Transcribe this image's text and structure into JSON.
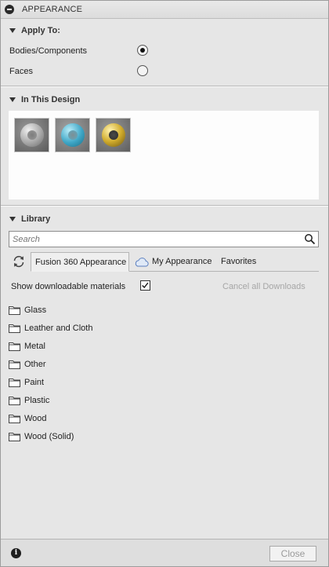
{
  "panel": {
    "title": "APPEARANCE"
  },
  "apply_to": {
    "header": "Apply To:",
    "options": [
      {
        "label": "Bodies/Components",
        "selected": true
      },
      {
        "label": "Faces",
        "selected": false
      }
    ]
  },
  "in_this_design": {
    "header": "In This Design",
    "swatches": [
      {
        "name": "clear-glass-swatch",
        "ring_color": "#c9c9c9",
        "bg": "#6d6d6d"
      },
      {
        "name": "blue-glass-swatch",
        "ring_color": "#3fa9c9",
        "bg": "#7a7a7a"
      },
      {
        "name": "gold-metal-swatch",
        "ring_color": "#c9a52b",
        "bg": "#6f6f6f"
      }
    ]
  },
  "library": {
    "header": "Library",
    "search_placeholder": "Search",
    "tabs": [
      {
        "label": "Fusion 360 Appearance",
        "active": true
      },
      {
        "label": "My Appearance",
        "active": false
      },
      {
        "label": "Favorites",
        "active": false
      }
    ],
    "show_downloadable_label": "Show downloadable materials",
    "show_downloadable_checked": true,
    "cancel_downloads_label": "Cancel all Downloads",
    "folders": [
      "Glass",
      "Leather and Cloth",
      "Metal",
      "Other",
      "Paint",
      "Plastic",
      "Wood",
      "Wood (Solid)"
    ]
  },
  "footer": {
    "close_label": "Close",
    "info_icon": "info-icon"
  }
}
